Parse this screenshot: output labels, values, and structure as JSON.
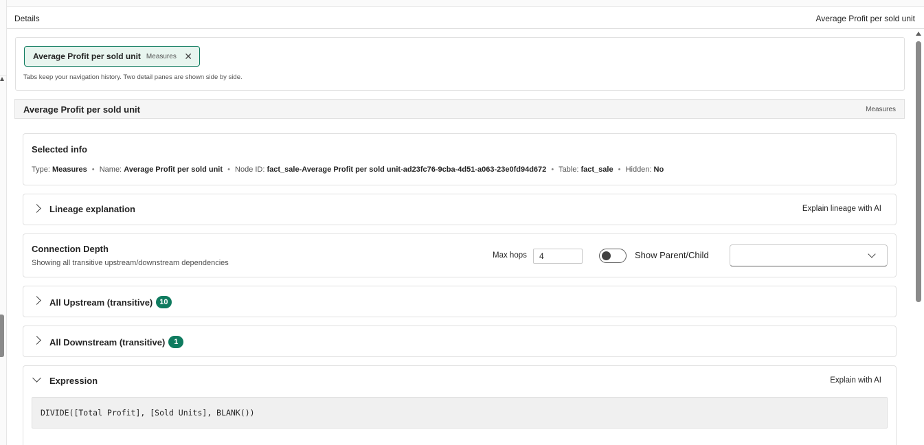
{
  "header": {
    "title": "Details",
    "right_title": "Average Profit per sold unit"
  },
  "tabs": {
    "items": [
      {
        "name": "Average Profit per sold unit",
        "type": "Measures"
      }
    ],
    "hint": "Tabs keep your navigation history. Two detail panes are shown side by side."
  },
  "node": {
    "name": "Average Profit per sold unit",
    "type": "Measures"
  },
  "selected_info": {
    "heading": "Selected info",
    "type_label": "Type:",
    "type_value": "Measures",
    "name_label": "Name:",
    "name_value": "Average Profit per sold unit",
    "node_id_label": "Node ID:",
    "node_id_value": "fact_sale-Average Profit per sold unit-ad23fc76-9cba-4d51-a063-23e0fd94d672",
    "table_label": "Table:",
    "table_value": "fact_sale",
    "hidden_label": "Hidden:",
    "hidden_value": "No"
  },
  "lineage": {
    "label": "Lineage explanation",
    "action": "Explain lineage with AI"
  },
  "depth": {
    "heading": "Connection Depth",
    "subtitle": "Showing all transitive upstream/downstream dependencies",
    "max_hops_label": "Max hops",
    "max_hops_value": "4",
    "toggle_label": "Show Parent/Child",
    "toggle_on": false,
    "dropdown_value": ""
  },
  "upstream": {
    "label": "All Upstream (transitive)",
    "count": "10"
  },
  "downstream": {
    "label": "All Downstream (transitive)",
    "count": "1"
  },
  "expression": {
    "label": "Expression",
    "action": "Explain with AI",
    "code": "DIVIDE([Total Profit], [Sold Units], BLANK())"
  },
  "colors": {
    "accent": "#0f7b5f",
    "chip_bg": "#e8f5ef"
  },
  "icons": {
    "tab_close": "close-icon",
    "expand": "chevron-right-icon",
    "collapse": "chevron-down-icon",
    "dropdown": "chevron-down-icon"
  }
}
